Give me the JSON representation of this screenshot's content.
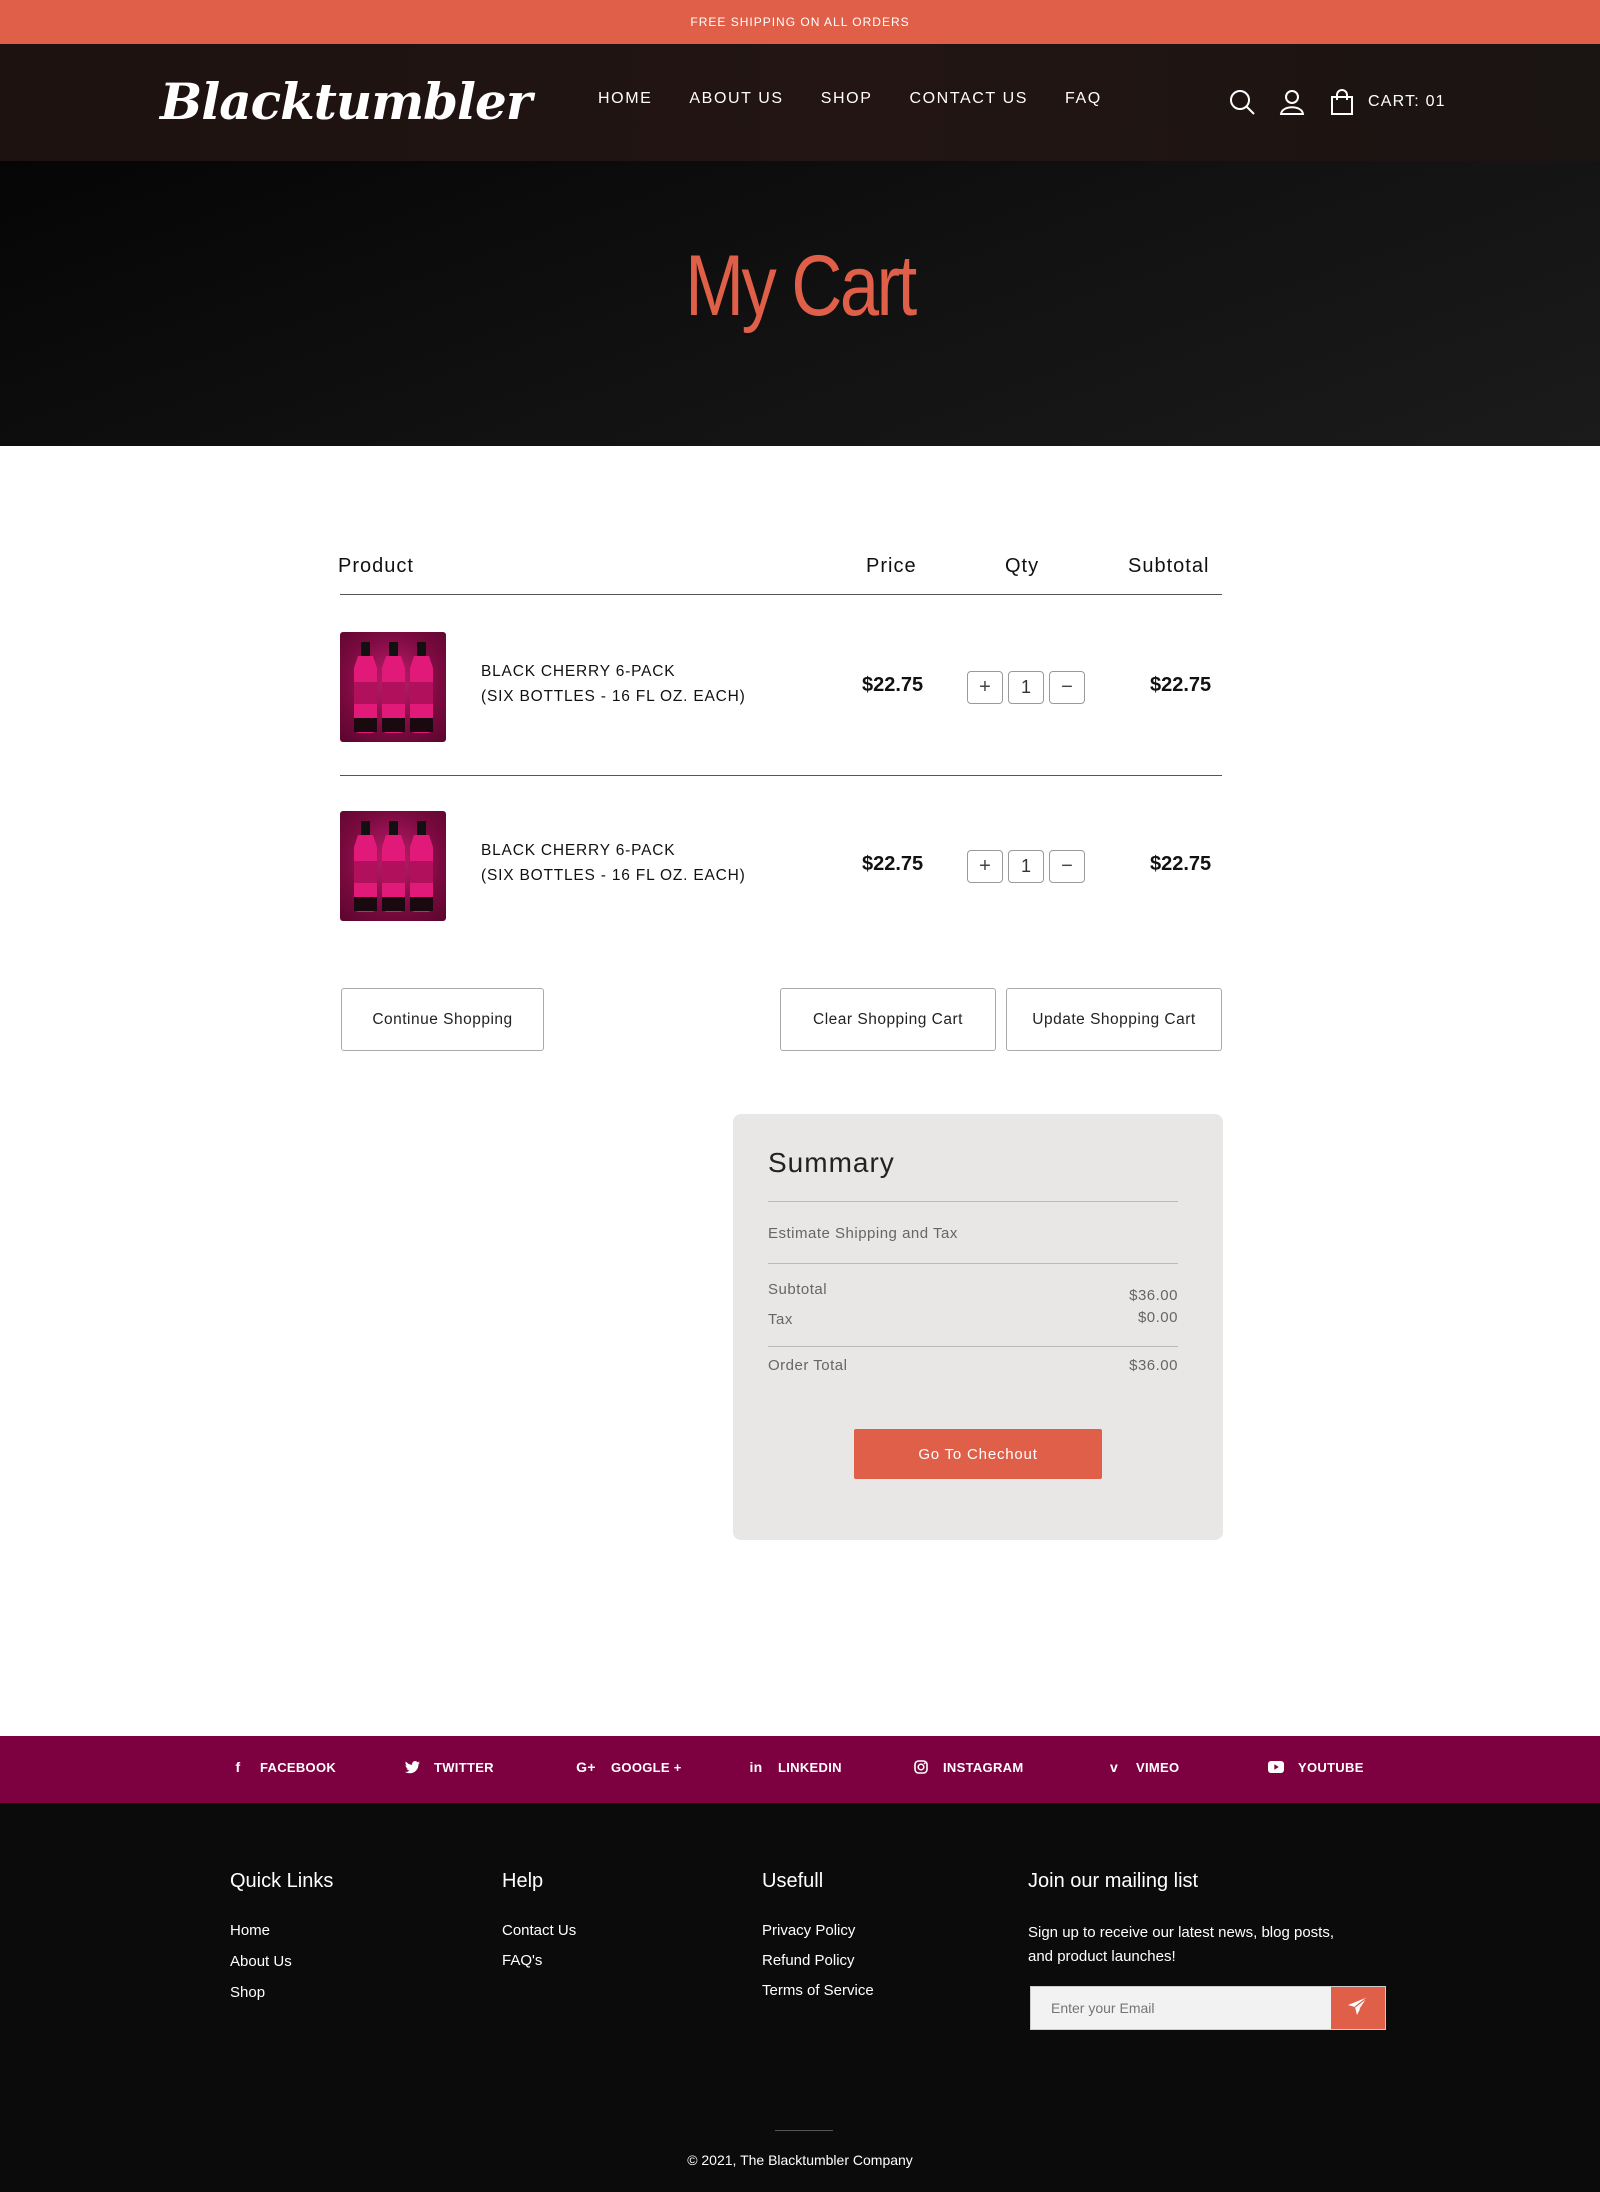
{
  "announcement": {
    "text": "FREE SHIPPING ON ALL ORDERS"
  },
  "header": {
    "logo": "Blacktumbler",
    "nav": [
      "HOME",
      "ABOUT US",
      "SHOP",
      "CONTACT US",
      "FAQ"
    ],
    "icons": [
      "search-icon",
      "user-icon",
      "shopping-bag-icon"
    ],
    "cart_label": "CART: 01"
  },
  "hero": {
    "title": "My Cart"
  },
  "cart": {
    "columns": {
      "product": "Product",
      "price": "Price",
      "qty": "Qty",
      "subtotal": "Subtotal"
    },
    "items": [
      {
        "name_line1": "BLACK CHERRY 6-PACK",
        "name_line2": "(SIX BOTTLES - 16 FL OZ. EACH)",
        "price": "$22.75",
        "qty": "1",
        "subtotal": "$22.75",
        "plus": "+",
        "minus": "−"
      },
      {
        "name_line1": "BLACK CHERRY 6-PACK",
        "name_line2": "(SIX BOTTLES - 16 FL OZ. EACH)",
        "price": "$22.75",
        "qty": "1",
        "subtotal": "$22.75",
        "plus": "+",
        "minus": "−"
      }
    ],
    "buttons": {
      "continue": "Continue Shopping",
      "clear": "Clear Shopping Cart",
      "update": "Update Shopping Cart"
    }
  },
  "summary": {
    "title": "Summary",
    "estimate": "Estimate Shipping and Tax",
    "subtotal_label": "Subtotal",
    "subtotal_value": "$36.00",
    "tax_label": "Tax",
    "tax_value": "$0.00",
    "order_total_label": "Order Total",
    "order_total_value": "$36.00",
    "checkout": "Go To Chechout"
  },
  "social": [
    {
      "label": "FACEBOOK",
      "icon": "facebook-icon"
    },
    {
      "label": "TWITTER",
      "icon": "twitter-icon"
    },
    {
      "label": "GOOGLE +",
      "icon": "google-plus-icon"
    },
    {
      "label": "LINKEDIN",
      "icon": "linkedin-icon"
    },
    {
      "label": "INSTAGRAM",
      "icon": "instagram-icon"
    },
    {
      "label": "VIMEO",
      "icon": "vimeo-icon"
    },
    {
      "label": "YOUTUBE",
      "icon": "youtube-icon"
    }
  ],
  "footer": {
    "quick_links": {
      "title": "Quick Links",
      "links": [
        "Home",
        "About Us",
        "Shop"
      ]
    },
    "help": {
      "title": "Help",
      "links": [
        "Contact Us",
        "FAQ's"
      ]
    },
    "useful": {
      "title": "Usefull",
      "links": [
        "Privacy Policy",
        "Refund Policy",
        "Terms of Service"
      ]
    },
    "mailing": {
      "title": "Join our mailing list",
      "description": "Sign up to receive our latest news, blog posts, and product launches!",
      "placeholder": "Enter your Email",
      "send_icon": "paper-plane-icon"
    },
    "copyright": "© 2021, The Blacktumbler Company"
  },
  "colors": {
    "accent": "#e05f48",
    "social_bar": "#7d0040",
    "footer_bg": "#0b0b0b",
    "summary_bg": "#e9e7e5"
  }
}
